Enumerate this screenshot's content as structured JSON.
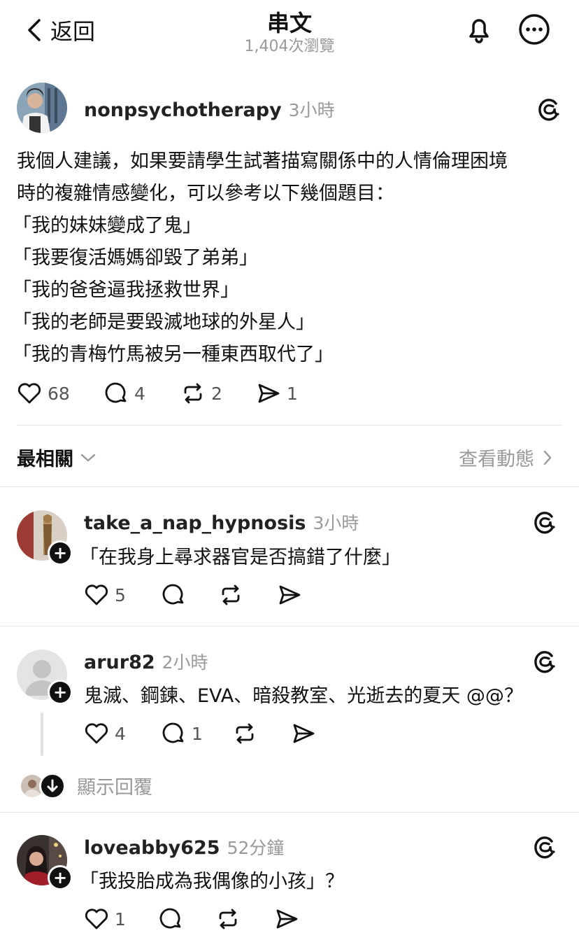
{
  "header": {
    "back_label": "返回",
    "title": "串文",
    "views": "1,404次瀏覽"
  },
  "post": {
    "username": "nonpsychotherapy",
    "time": "3小時",
    "lines": [
      "我個人建議，如果要請學生試著描寫關係中的人情倫理困境",
      "時的複雜情感變化，可以參考以下幾個題目：",
      "「我的妹妹變成了鬼」",
      "「我要復活媽媽卻毀了弟弟」",
      "「我的爸爸逼我拯救世界」",
      "「我的老師是要毀滅地球的外星人」",
      "「我的青梅竹馬被另一種東西取代了」"
    ],
    "likes": "68",
    "comments": "4",
    "reposts": "2",
    "shares": "1"
  },
  "sort": {
    "label": "最相關",
    "activity_label": "查看動態"
  },
  "replies": [
    {
      "username": "take_a_nap_hypnosis",
      "time": "3小時",
      "text": "「在我身上尋求器官是否搞錯了什麼」",
      "likes": "5",
      "comments": "",
      "reposts": "",
      "shares": ""
    },
    {
      "username": "arur82",
      "time": "2小時",
      "text": "鬼滅、鋼鍊、EVA、暗殺教室、光逝去的夏天 @@？",
      "likes": "4",
      "comments": "1",
      "reposts": "",
      "shares": ""
    },
    {
      "username": "loveabby625",
      "time": "52分鐘",
      "text": "「我投胎成為我偶像的小孩」？",
      "likes": "1",
      "comments": "",
      "reposts": "",
      "shares": ""
    }
  ],
  "show_replies_label": "顯示回覆",
  "plus_glyph": "+",
  "colors": {
    "accent": "#111111",
    "muted": "#999999",
    "divider": "#e2e2e2"
  },
  "icons": [
    "chevron-left-icon",
    "bell-icon",
    "more-icon",
    "threads-logo-icon",
    "heart-icon",
    "comment-icon",
    "repost-icon",
    "share-icon",
    "chevron-down-icon",
    "chevron-right-icon",
    "arrow-down-icon"
  ]
}
